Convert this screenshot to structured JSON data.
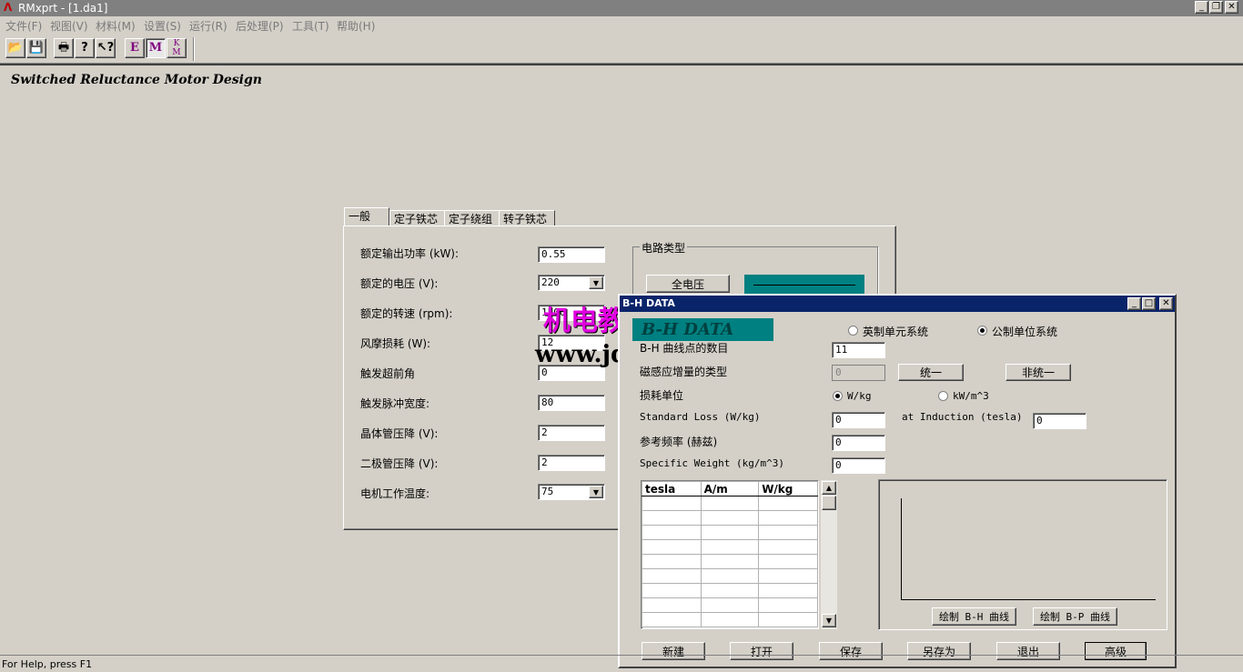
{
  "window": {
    "title": "RMxprt - [1.da1]"
  },
  "menu": [
    "文件(F)",
    "视图(V)",
    "材料(M)",
    "设置(S)",
    "运行(R)",
    "后处理(P)",
    "工具(T)",
    "帮助(H)"
  ],
  "toolbar": {
    "e_label": "E",
    "m_label": "M",
    "km_label": "K",
    "km_sub": "M"
  },
  "heading": "Switched Reluctance Motor Design",
  "tabs": [
    "一般",
    "定子铁芯",
    "定子绕组",
    "转子铁芯"
  ],
  "general": {
    "fields": [
      {
        "label": "额定输出功率 (kW):",
        "value": "0.55"
      },
      {
        "label": "额定的电压 (V):",
        "value": "220"
      },
      {
        "label": "额定的转速 (rpm):",
        "value": "1500"
      },
      {
        "label": "风摩损耗 (W):",
        "value": "12"
      },
      {
        "label": "触发超前角",
        "value": "0"
      },
      {
        "label": "触发脉冲宽度:",
        "value": "80"
      },
      {
        "label": "晶体管压降 (V):",
        "value": "2"
      },
      {
        "label": "二极管压降 (V):",
        "value": "2"
      },
      {
        "label": "电机工作温度:",
        "value": "75"
      }
    ],
    "circuit_group": "电路类型",
    "full_voltage": "全电压"
  },
  "status": "For Help, press F1",
  "bh": {
    "title": "B-H DATA",
    "banner": "B-H DATA",
    "unit_english": "英制单元系统",
    "unit_metric": "公制单位系统",
    "points_label": "B-H 曲线点的数目",
    "points_value": "11",
    "type_label": "磁感应增量的类型",
    "type_value": "0",
    "uniform": "统一",
    "nonuniform": "非统一",
    "loss_unit_label": "损耗单位",
    "loss_wkg": "W/kg",
    "loss_kwm3": "kW/m^3",
    "std_loss_label": "Standard Loss (W/kg)",
    "std_loss_value": "0",
    "induction_label": "at Induction (tesla)",
    "induction_value": "0",
    "ref_freq_label": "参考频率 (赫兹)",
    "ref_freq_value": "0",
    "spec_weight_label": "Specific Weight (kg/m^3)",
    "spec_weight_value": "0",
    "columns": [
      "tesla",
      "A/m",
      "W/kg"
    ],
    "plot_bh": "绘制 B-H 曲线",
    "plot_bp": "绘制 B-P 曲线",
    "buttons": [
      "新建",
      "打开",
      "保存",
      "另存为",
      "退出",
      "高级"
    ]
  },
  "watermark": {
    "cn": "机电教程网",
    "url": "www.jdjcy.com"
  },
  "colors": {
    "titlebar_inactive": "#808080",
    "titlebar_active": "#0a246a",
    "teal": "#008080",
    "face": "#d4d0c8"
  }
}
